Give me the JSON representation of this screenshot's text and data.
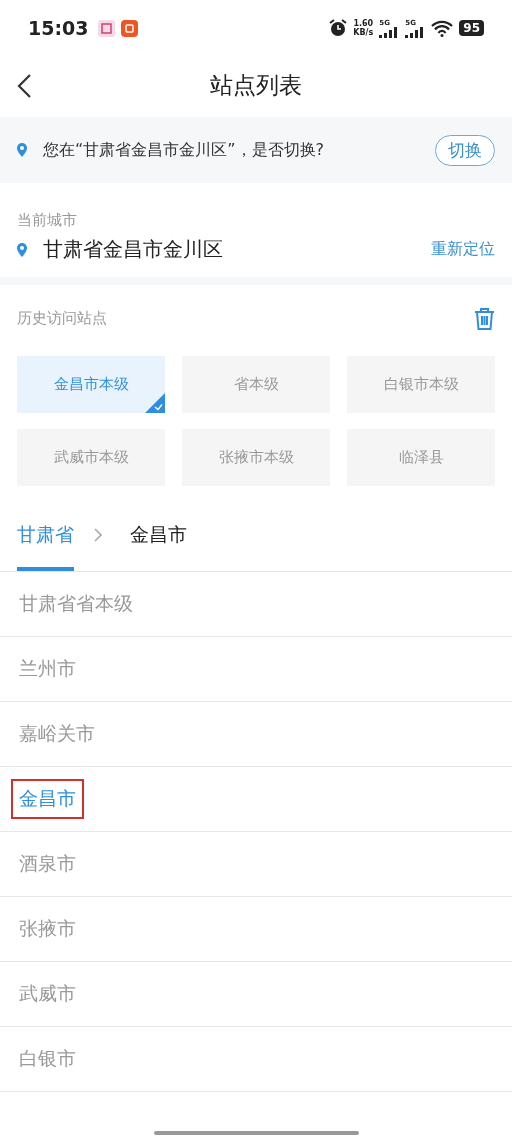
{
  "status_bar": {
    "time": "15:03",
    "network_speed": "1.60",
    "network_speed_unit": "KB/s",
    "signals": [
      {
        "label": "5G"
      },
      {
        "label": "5G"
      }
    ],
    "battery": "95"
  },
  "header": {
    "title": "站点列表"
  },
  "location_prompt": {
    "text": "您在“甘肃省金昌市金川区”，是否切换?",
    "button": "切换"
  },
  "current_city": {
    "label": "当前城市",
    "city": "甘肃省金昌市金川区",
    "relocate": "重新定位"
  },
  "history": {
    "label": "历史访问站点",
    "sites": [
      {
        "name": "金昌市本级",
        "selected": true
      },
      {
        "name": "省本级",
        "selected": false
      },
      {
        "name": "白银市本级",
        "selected": false
      },
      {
        "name": "武威市本级",
        "selected": false
      },
      {
        "name": "张掖市本级",
        "selected": false
      },
      {
        "name": "临泽县",
        "selected": false
      }
    ]
  },
  "breadcrumb": [
    {
      "label": "甘肃省",
      "selected": true
    },
    {
      "label": "金昌市",
      "selected": false
    }
  ],
  "regions": [
    {
      "name": "甘肃省省本级",
      "selected": false,
      "outlined": false
    },
    {
      "name": "兰州市",
      "selected": false,
      "outlined": false
    },
    {
      "name": "嘉峪关市",
      "selected": false,
      "outlined": false
    },
    {
      "name": "金昌市",
      "selected": true,
      "outlined": true
    },
    {
      "name": "酒泉市",
      "selected": false,
      "outlined": false
    },
    {
      "name": "张掖市",
      "selected": false,
      "outlined": false
    },
    {
      "name": "武威市",
      "selected": false,
      "outlined": false
    },
    {
      "name": "白银市",
      "selected": false,
      "outlined": false
    }
  ]
}
